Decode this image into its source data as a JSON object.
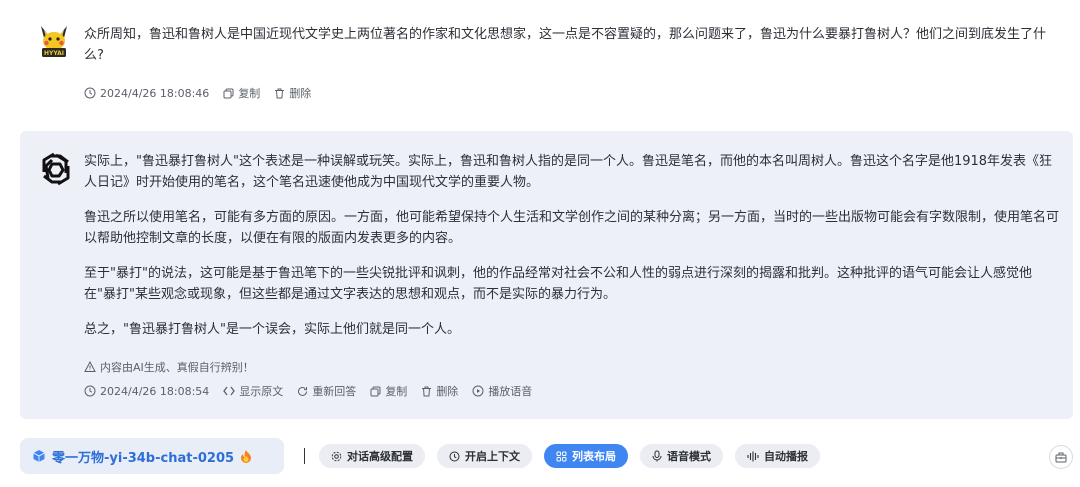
{
  "user_message": {
    "avatar": "pikachu-avatar",
    "avatar_caption": "HYYAI",
    "text": "众所周知，鲁迅和鲁树人是中国近现代文学史上两位著名的作家和文化思想家，这一点是不容置疑的，那么问题来了，鲁迅为什么要暴打鲁树人？他们之间到底发生了什么?",
    "timestamp": "2024/4/26 18:08:46",
    "copy_label": "复制",
    "delete_label": "删除"
  },
  "assistant_message": {
    "avatar": "openai-logo",
    "paragraphs": [
      "实际上，\"鲁迅暴打鲁树人\"这个表述是一种误解或玩笑。实际上，鲁迅和鲁树人指的是同一个人。鲁迅是笔名，而他的本名叫周树人。鲁迅这个名字是他1918年发表《狂人日记》时开始使用的笔名，这个笔名迅速使他成为中国现代文学的重要人物。",
      "鲁迅之所以使用笔名，可能有多方面的原因。一方面，他可能希望保持个人生活和文学创作之间的某种分离；另一方面，当时的一些出版物可能会有字数限制，使用笔名可以帮助他控制文章的长度，以便在有限的版面内发表更多的内容。",
      "至于\"暴打\"的说法，这可能是基于鲁迅笔下的一些尖锐批评和讽刺，他的作品经常对社会不公和人性的弱点进行深刻的揭露和批判。这种批评的语气可能会让人感觉他在\"暴打\"某些观念或现象，但这些都是通过文字表达的思想和观点，而不是实际的暴力行为。",
      "总之，\"鲁迅暴打鲁树人\"是一个误会，实际上他们就是同一个人。"
    ],
    "notice": "内容由AI生成、真假自行辨别！",
    "timestamp": "2024/4/26 18:08:54",
    "show_source_label": "显示原文",
    "regenerate_label": "重新回答",
    "copy_label": "复制",
    "delete_label": "删除",
    "play_voice_label": "播放语音"
  },
  "toolbar": {
    "model_name": "零一万物-yi-34b-chat-0205",
    "buttons": {
      "advanced_config": "对话高级配置",
      "context": "开启上下文",
      "list_layout": "列表布局",
      "voice_mode": "语音模式",
      "auto_play": "自动播报"
    },
    "accent_color": "#3f86f2",
    "model_color": "#2c6fd6"
  },
  "colors": {
    "card_bg": "#eef0f8",
    "text": "#2b2f36",
    "meta": "#5a606b"
  }
}
